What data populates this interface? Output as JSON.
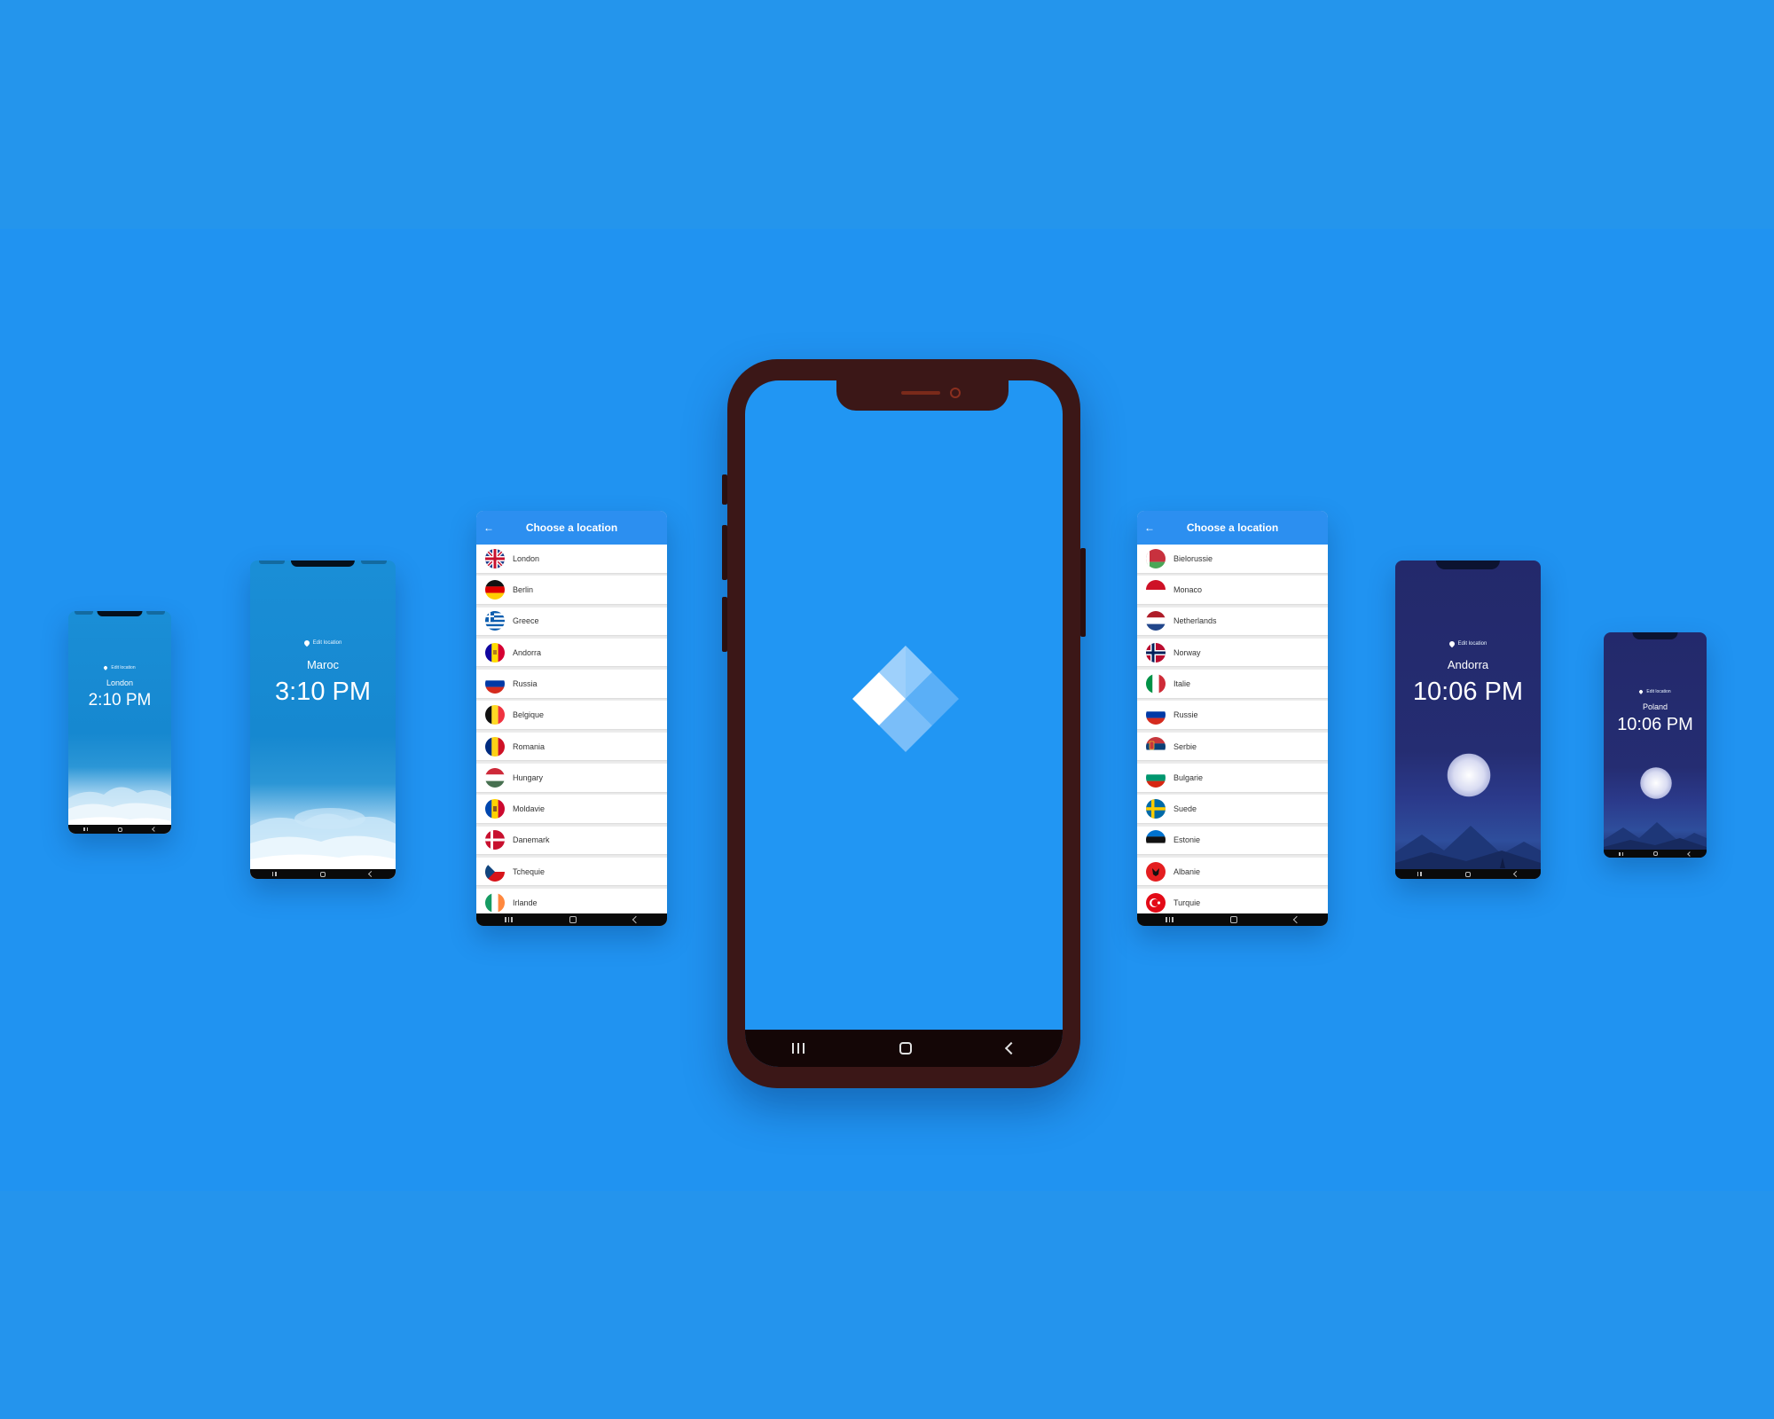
{
  "phones": {
    "london": {
      "edit_label": "Edit location",
      "city": "London",
      "time": "2:10 PM"
    },
    "maroc": {
      "edit_label": "Edit location",
      "city": "Maroc",
      "time": "3:10 PM"
    },
    "andorra": {
      "edit_label": "Edit location",
      "city": "Andorra",
      "time": "10:06 PM"
    },
    "poland": {
      "edit_label": "Edit location",
      "city": "Poland",
      "time": "10:06 PM"
    }
  },
  "list_left": {
    "title": "Choose a location",
    "back_icon": "arrow-left-icon",
    "items": [
      {
        "label": "London",
        "flag": "uk-flag-icon"
      },
      {
        "label": "Berlin",
        "flag": "germany-flag-icon"
      },
      {
        "label": "Greece",
        "flag": "greece-flag-icon"
      },
      {
        "label": "Andorra",
        "flag": "andorra-flag-icon"
      },
      {
        "label": "Russia",
        "flag": "russia-flag-icon"
      },
      {
        "label": "Belgique",
        "flag": "belgium-flag-icon"
      },
      {
        "label": "Romania",
        "flag": "romania-flag-icon"
      },
      {
        "label": "Hungary",
        "flag": "hungary-flag-icon"
      },
      {
        "label": "Moldavie",
        "flag": "moldova-flag-icon"
      },
      {
        "label": "Danemark",
        "flag": "denmark-flag-icon"
      },
      {
        "label": "Tchequie",
        "flag": "czech-flag-icon"
      },
      {
        "label": "Irlande",
        "flag": "ireland-flag-icon"
      }
    ]
  },
  "list_right": {
    "title": "Choose a location",
    "back_icon": "arrow-left-icon",
    "items": [
      {
        "label": "Bielorussie",
        "flag": "belarus-flag-icon"
      },
      {
        "label": "Monaco",
        "flag": "monaco-flag-icon"
      },
      {
        "label": "Netherlands",
        "flag": "netherlands-flag-icon"
      },
      {
        "label": "Norway",
        "flag": "norway-flag-icon"
      },
      {
        "label": "Italie",
        "flag": "italy-flag-icon"
      },
      {
        "label": "Russie",
        "flag": "russia-flag-icon"
      },
      {
        "label": "Serbie",
        "flag": "serbia-flag-icon"
      },
      {
        "label": "Bulgarie",
        "flag": "bulgaria-flag-icon"
      },
      {
        "label": "Suede",
        "flag": "sweden-flag-icon"
      },
      {
        "label": "Estonie",
        "flag": "estonia-flag-icon"
      },
      {
        "label": "Albanie",
        "flag": "albania-flag-icon"
      },
      {
        "label": "Turquie",
        "flag": "turkey-flag-icon"
      }
    ]
  },
  "center_phone": {
    "logo": "app-logo-diamond-icon"
  },
  "nav_icons": [
    "recent-apps-icon",
    "home-icon",
    "back-icon"
  ],
  "colors": {
    "background": "#2193ee",
    "day_sky": "#1688d0",
    "night_sky": "#252d72",
    "list_header": "#2c8ff0",
    "phone_frame": "#3b1717"
  }
}
